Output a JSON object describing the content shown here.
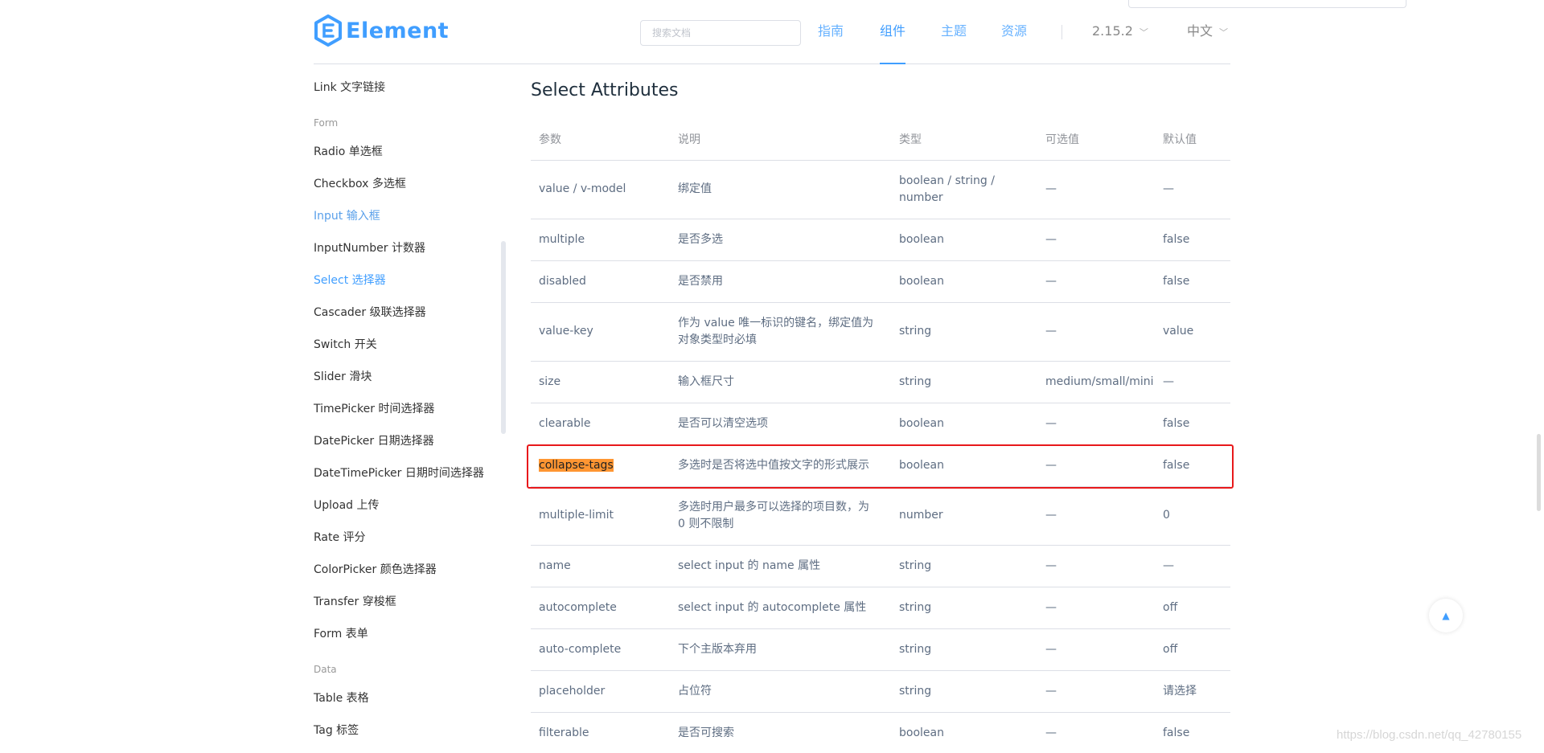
{
  "header": {
    "logo_text": "Element",
    "search_placeholder": "搜索文档",
    "nav": [
      "指南",
      "组件",
      "主题",
      "资源"
    ],
    "nav_active": "组件",
    "version": "2.15.2",
    "language": "中文"
  },
  "sidebar": {
    "items": [
      {
        "type": "item",
        "label": "Link 文字链接"
      },
      {
        "type": "group",
        "label": "Form"
      },
      {
        "type": "item",
        "label": "Radio 单选框"
      },
      {
        "type": "item",
        "label": "Checkbox 多选框"
      },
      {
        "type": "item",
        "label": "Input 输入框",
        "state": "hover"
      },
      {
        "type": "item",
        "label": "InputNumber 计数器"
      },
      {
        "type": "item",
        "label": "Select 选择器",
        "state": "active"
      },
      {
        "type": "item",
        "label": "Cascader 级联选择器"
      },
      {
        "type": "item",
        "label": "Switch 开关"
      },
      {
        "type": "item",
        "label": "Slider 滑块"
      },
      {
        "type": "item",
        "label": "TimePicker 时间选择器"
      },
      {
        "type": "item",
        "label": "DatePicker 日期选择器"
      },
      {
        "type": "item",
        "label": "DateTimePicker 日期时间选择器"
      },
      {
        "type": "item",
        "label": "Upload 上传"
      },
      {
        "type": "item",
        "label": "Rate 评分"
      },
      {
        "type": "item",
        "label": "ColorPicker 颜色选择器"
      },
      {
        "type": "item",
        "label": "Transfer 穿梭框"
      },
      {
        "type": "item",
        "label": "Form 表单"
      },
      {
        "type": "group",
        "label": "Data"
      },
      {
        "type": "item",
        "label": "Table 表格"
      },
      {
        "type": "item",
        "label": "Tag 标签"
      }
    ]
  },
  "main": {
    "title": "Select Attributes",
    "columns": [
      "参数",
      "说明",
      "类型",
      "可选值",
      "默认值"
    ],
    "rows": [
      [
        "value / v-model",
        "绑定值",
        "boolean / string / number",
        "—",
        "—"
      ],
      [
        "multiple",
        "是否多选",
        "boolean",
        "—",
        "false"
      ],
      [
        "disabled",
        "是否禁用",
        "boolean",
        "—",
        "false"
      ],
      [
        "value-key",
        "作为 value 唯一标识的键名，绑定值为对象类型时必填",
        "string",
        "—",
        "value"
      ],
      [
        "size",
        "输入框尺寸",
        "string",
        "medium/small/mini",
        "—"
      ],
      [
        "clearable",
        "是否可以清空选项",
        "boolean",
        "—",
        "false"
      ],
      [
        "collapse-tags",
        "多选时是否将选中值按文字的形式展示",
        "boolean",
        "—",
        "false"
      ],
      [
        "multiple-limit",
        "多选时用户最多可以选择的项目数，为 0 则不限制",
        "number",
        "—",
        "0"
      ],
      [
        "name",
        "select input 的 name 属性",
        "string",
        "—",
        "—"
      ],
      [
        "autocomplete",
        "select input 的 autocomplete 属性",
        "string",
        "—",
        "off"
      ],
      [
        "auto-complete",
        "下个主版本弃用",
        "string",
        "—",
        "off"
      ],
      [
        "placeholder",
        "占位符",
        "string",
        "—",
        "请选择"
      ],
      [
        "filterable",
        "是否可搜索",
        "boolean",
        "—",
        "false"
      ]
    ],
    "highlighted_row_param": "collapse-tags"
  },
  "watermark": "https://blog.csdn.net/qq_42780155",
  "colors": {
    "accent": "#409eff",
    "highlight": "#ff9632",
    "annotation_box": "#e8191b"
  }
}
